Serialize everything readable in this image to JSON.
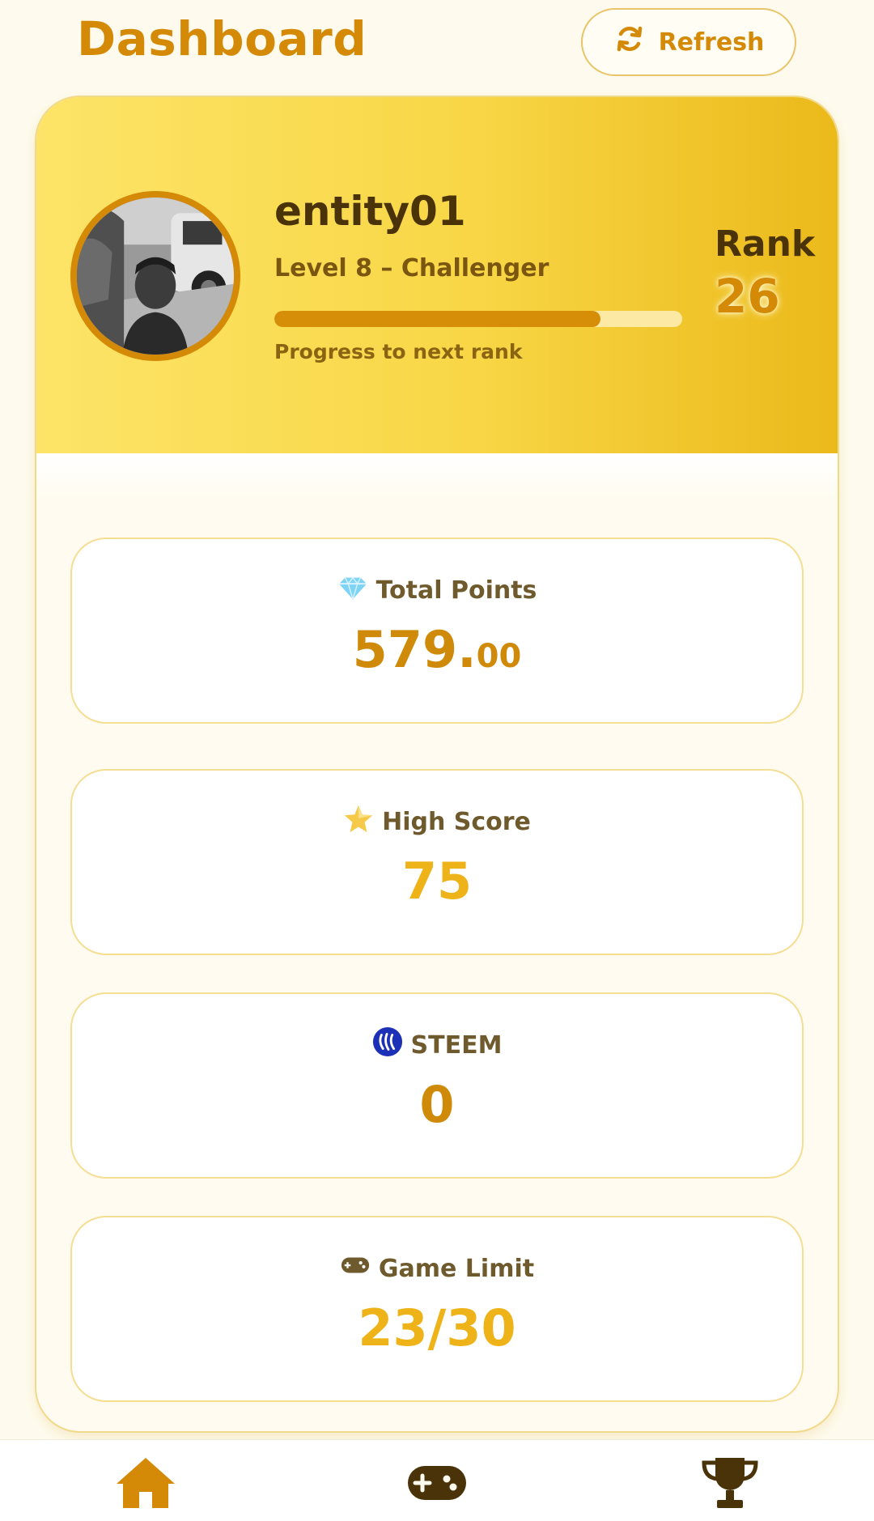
{
  "header": {
    "title": "Dashboard",
    "refresh_label": "Refresh",
    "refresh_icon": "refresh-icon"
  },
  "profile": {
    "username": "entity01",
    "level": "Level 8 – Challenger",
    "progress": 0.8,
    "progress_label": "Progress to next rank",
    "rank_label": "Rank",
    "rank_value": "26",
    "avatar_icon": "user-avatar-photo"
  },
  "stats": [
    {
      "label": "Total Points",
      "value_int": "579.",
      "value_dec": "00",
      "icon": "gem-icon"
    },
    {
      "label": "High Score",
      "value": "75",
      "icon": "star-icon"
    },
    {
      "label": "STEEM",
      "value": "0",
      "icon": "steem-icon"
    },
    {
      "label": "Game Limit",
      "value": "23/30",
      "icon": "gamepad-icon"
    }
  ],
  "nav": {
    "items": [
      "home-icon",
      "gamepad-icon",
      "trophy-icon"
    ],
    "active": "home"
  },
  "colors": {
    "accent": "#d48a06",
    "accent_light": "#efb31a",
    "background": "#fefbee",
    "header_gradient": [
      "#fde468",
      "#ebb91a"
    ]
  }
}
